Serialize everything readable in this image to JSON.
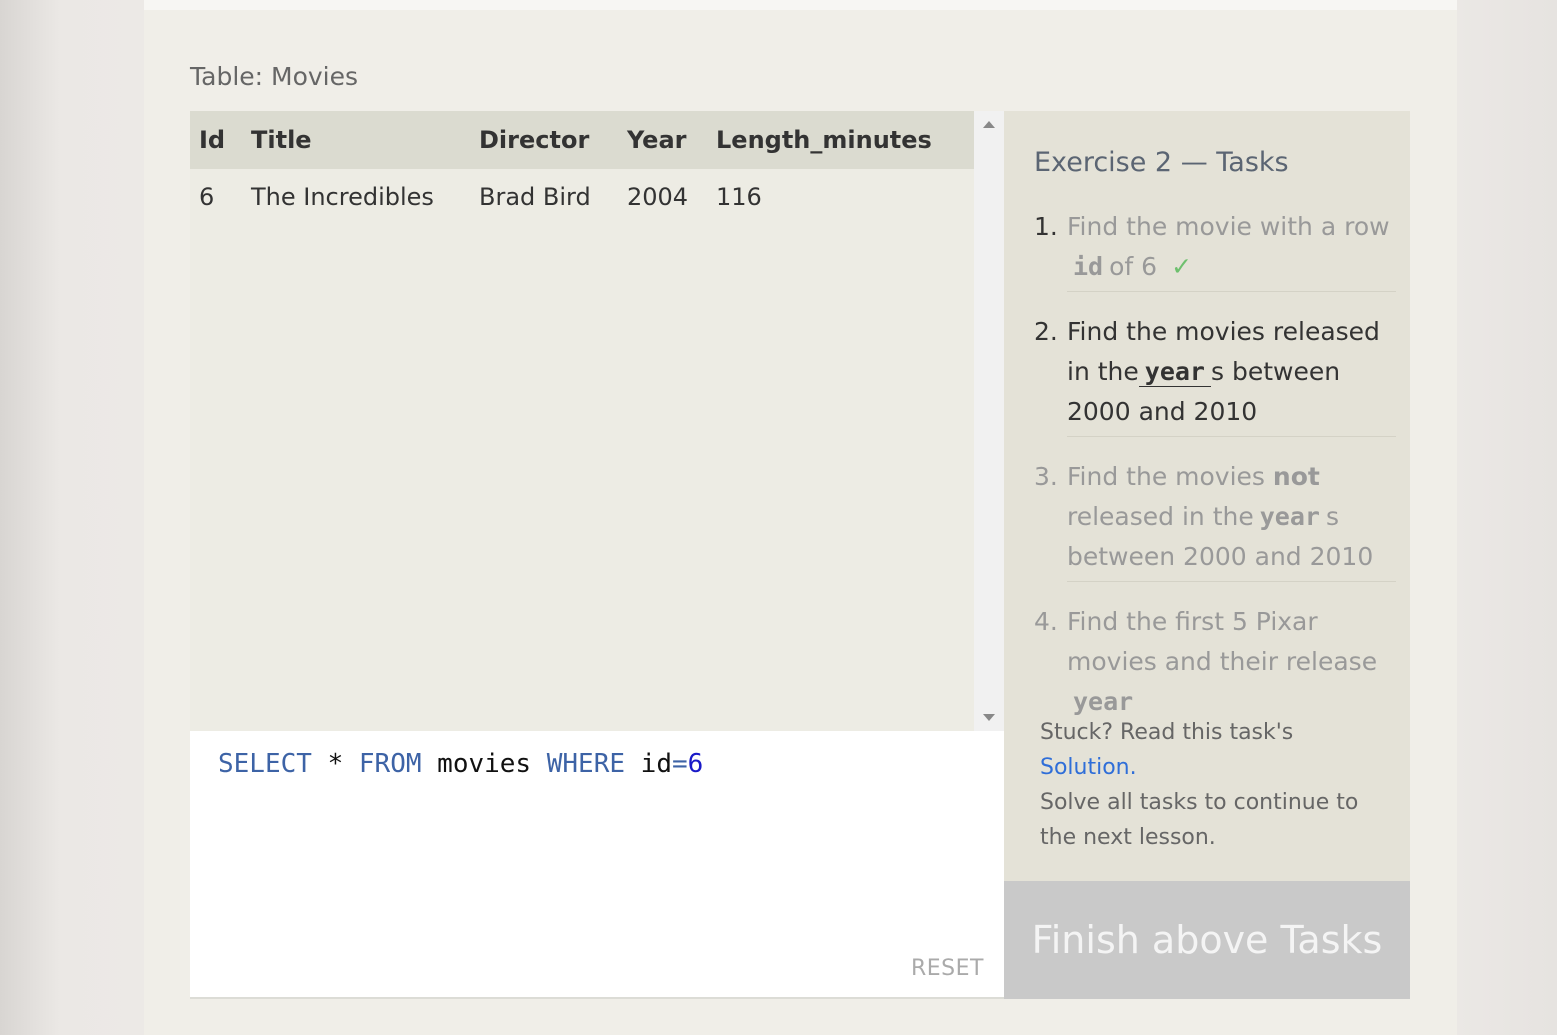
{
  "table_caption": "Table: Movies",
  "results": {
    "columns": [
      "Id",
      "Title",
      "Director",
      "Year",
      "Length_minutes"
    ],
    "rows": [
      [
        "6",
        "The Incredibles",
        "Brad Bird",
        "2004",
        "116"
      ]
    ]
  },
  "editor": {
    "code_parts": [
      "SELECT",
      " * ",
      "FROM",
      " movies ",
      "WHERE",
      " id",
      "=",
      "6"
    ],
    "reset_label": "RESET"
  },
  "tasks": {
    "title": "Exercise 2 — Tasks",
    "items": [
      {
        "num": "1.",
        "t1": "Find the movie with a row",
        "code": "id",
        "t2": "of 6",
        "check": "✓"
      },
      {
        "num": "2.",
        "t1": "Find the movies released in the",
        "code": "year",
        "t2": "s between 2000 and 2010"
      },
      {
        "num": "3.",
        "t1": "Find the movies",
        "bold": "not",
        "t2": "released in the",
        "code": "year",
        "t3": "s between 2000 and 2010"
      },
      {
        "num": "4.",
        "t1": "Find the first 5 Pixar movies and their release",
        "code": "year"
      }
    ],
    "hint_prefix": "Stuck? Read this task's",
    "hint_link": "Solution.",
    "hint_suffix": "Solve all tasks to continue to the next lesson.",
    "finish_label": "Finish above Tasks"
  }
}
